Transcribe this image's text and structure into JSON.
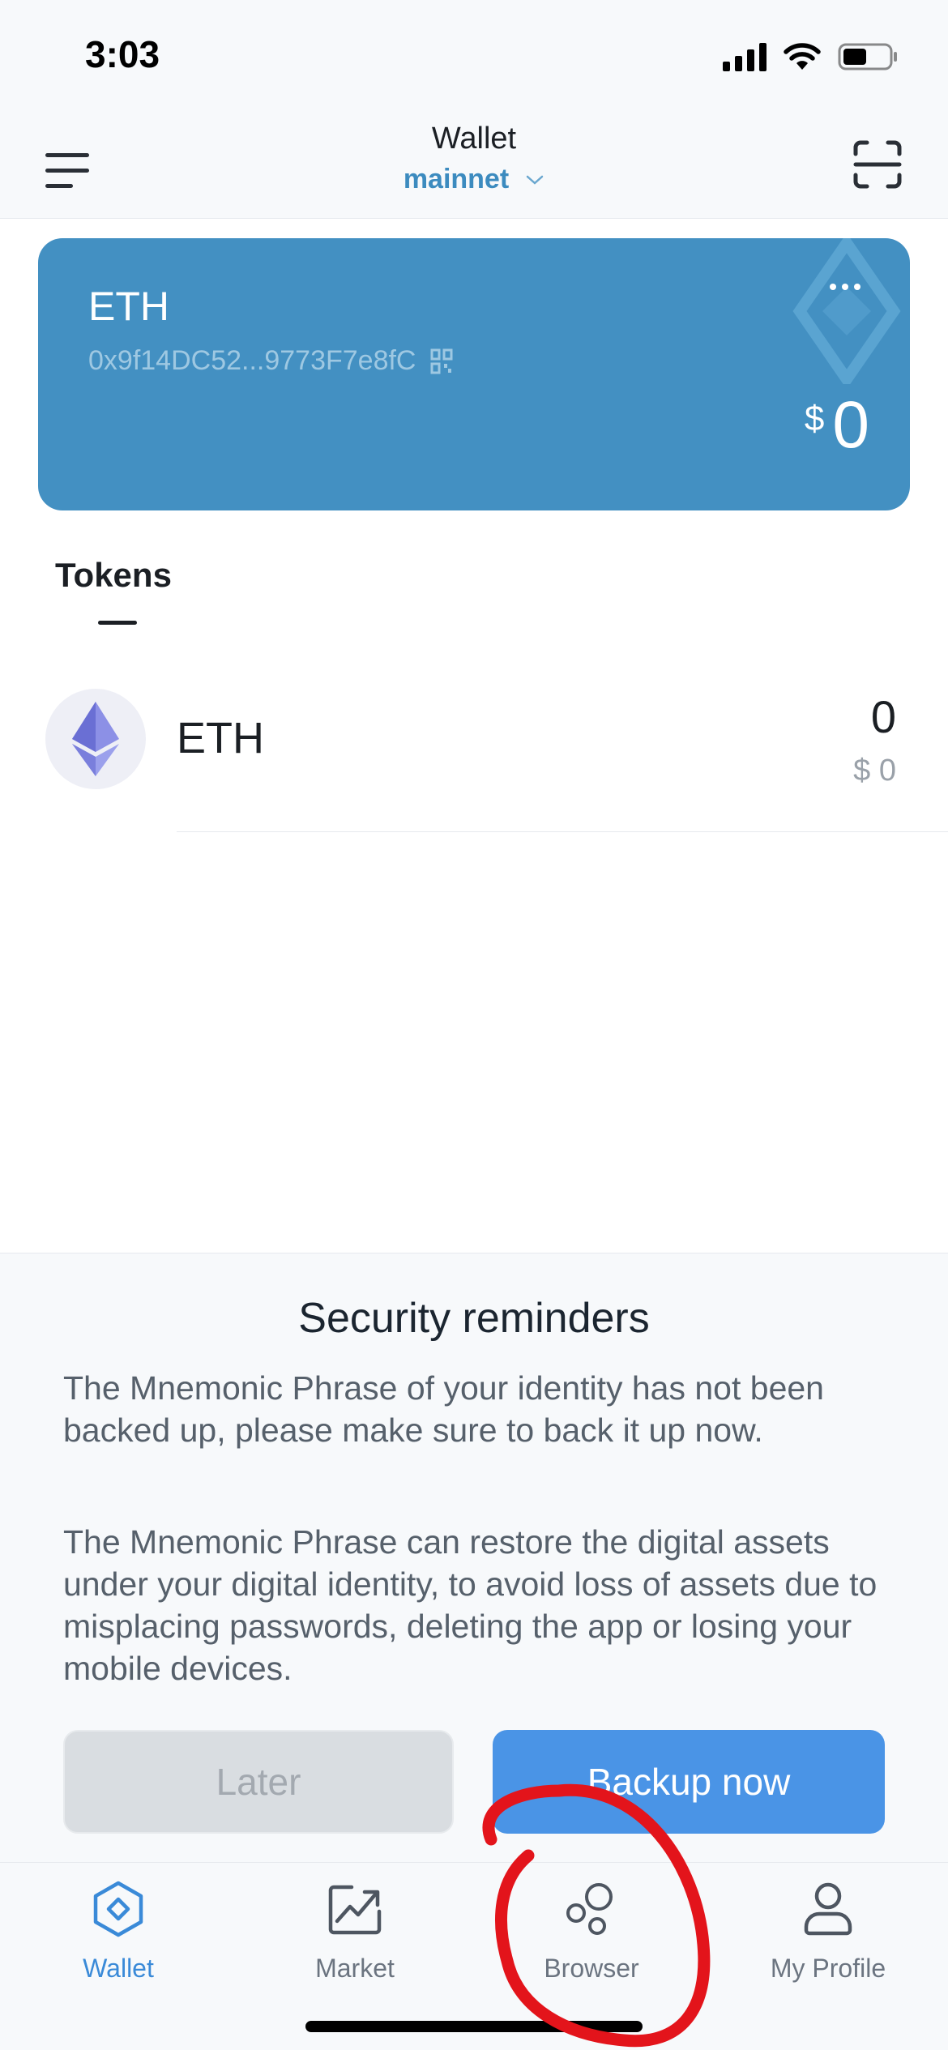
{
  "status_bar": {
    "time": "3:03"
  },
  "header": {
    "title": "Wallet",
    "network": "mainnet"
  },
  "card": {
    "symbol": "ETH",
    "address": "0x9f14DC52...9773F7e8fC",
    "currency": "$",
    "balance": "0",
    "color": "#4390c2"
  },
  "tokens_tab": {
    "label": "Tokens"
  },
  "tokens": [
    {
      "name": "ETH",
      "amount": "0",
      "fiat": "$ 0"
    }
  ],
  "security_reminder": {
    "title": "Security reminders",
    "paragraph1": "The Mnemonic Phrase of your identity has not been backed up, please make sure to back it up now.",
    "paragraph2": "The Mnemonic Phrase can restore the digital assets under your digital identity, to avoid loss of assets due to misplacing passwords, deleting the app or losing your mobile devices.",
    "later_label": "Later",
    "backup_label": "Backup now"
  },
  "tab_bar": {
    "items": [
      {
        "label": "Wallet",
        "icon": "wallet-hexagon-icon",
        "active": true
      },
      {
        "label": "Market",
        "icon": "market-chart-icon",
        "active": false
      },
      {
        "label": "Browser",
        "icon": "browser-bubbles-icon",
        "active": false
      },
      {
        "label": "My Profile",
        "icon": "profile-person-icon",
        "active": false
      }
    ]
  },
  "colors": {
    "accent": "#3a8ad8",
    "primary_button": "#4a94e6",
    "annotation": "#e3141b"
  }
}
